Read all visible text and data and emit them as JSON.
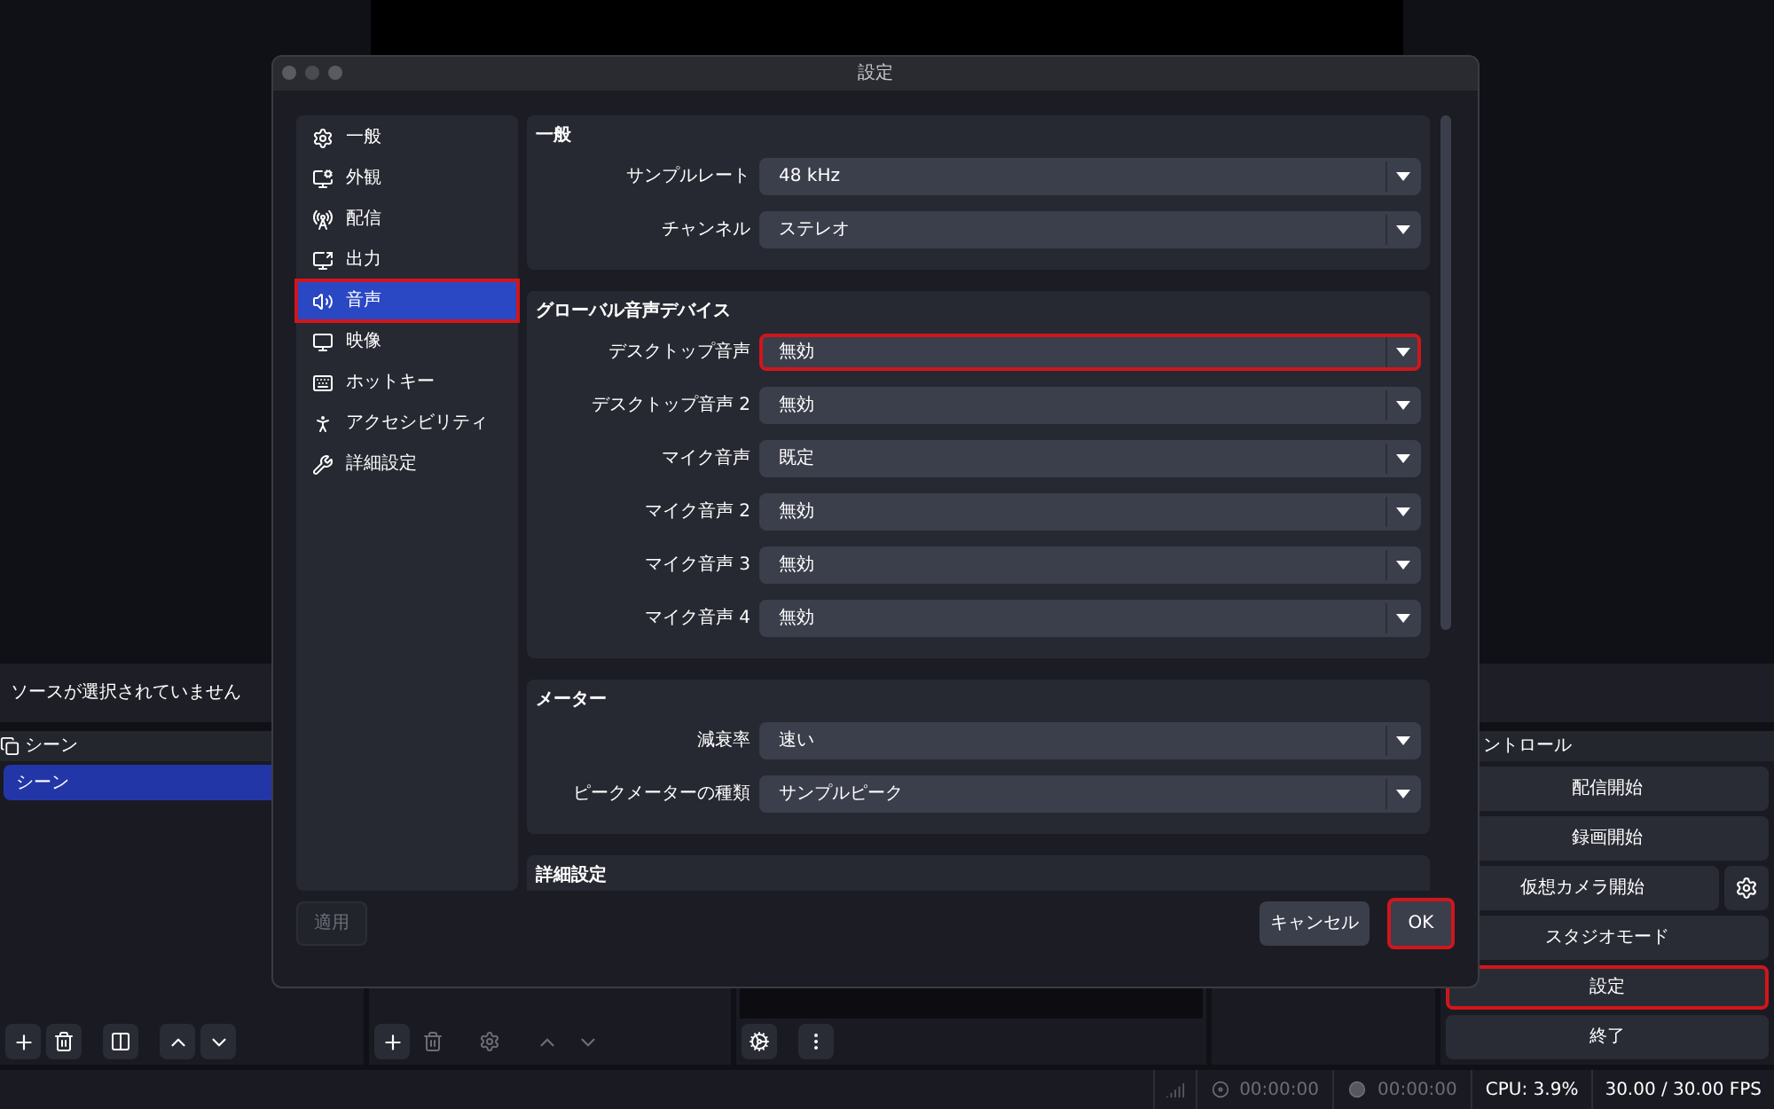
{
  "main_window": {
    "source_bar": {
      "text": "ソースが選択されていません"
    },
    "scenes_dock": {
      "title": "シーン",
      "items": [
        {
          "label": "シーン",
          "selected": true
        }
      ]
    },
    "controls_dock": {
      "title": "ントロール",
      "buttons": [
        {
          "label": "配信開始",
          "kind": "plain",
          "highlighted": false
        },
        {
          "label": "録画開始",
          "kind": "plain",
          "highlighted": false
        },
        {
          "label": "仮想カメラ開始",
          "kind": "with-settings",
          "highlighted": false
        },
        {
          "label": "スタジオモード",
          "kind": "plain",
          "highlighted": false
        },
        {
          "label": "設定",
          "kind": "plain",
          "highlighted": true
        },
        {
          "label": "終了",
          "kind": "plain",
          "highlighted": false
        }
      ]
    },
    "status_bar": {
      "stream_time": "00:00:00",
      "record_time": "00:00:00",
      "cpu": "CPU: 3.9%",
      "fps": "30.00 / 30.00 FPS"
    }
  },
  "dialog": {
    "title": "設定",
    "sidebar": [
      {
        "label": "一般",
        "selected": false,
        "highlighted": false
      },
      {
        "label": "外観",
        "selected": false,
        "highlighted": false
      },
      {
        "label": "配信",
        "selected": false,
        "highlighted": false
      },
      {
        "label": "出力",
        "selected": false,
        "highlighted": false
      },
      {
        "label": "音声",
        "selected": true,
        "highlighted": true
      },
      {
        "label": "映像",
        "selected": false,
        "highlighted": false
      },
      {
        "label": "ホットキー",
        "selected": false,
        "highlighted": false
      },
      {
        "label": "アクセシビリティ",
        "selected": false,
        "highlighted": false
      },
      {
        "label": "詳細設定",
        "selected": false,
        "highlighted": false
      }
    ],
    "sections": [
      {
        "title": "一般",
        "rows": [
          {
            "label": "サンプルレート",
            "value": "48 kHz",
            "highlighted": false
          },
          {
            "label": "チャンネル",
            "value": "ステレオ",
            "highlighted": false
          }
        ]
      },
      {
        "title": "グローバル音声デバイス",
        "rows": [
          {
            "label": "デスクトップ音声",
            "value": "無効",
            "highlighted": true
          },
          {
            "label": "デスクトップ音声 2",
            "value": "無効",
            "highlighted": false
          },
          {
            "label": "マイク音声",
            "value": "既定",
            "highlighted": false
          },
          {
            "label": "マイク音声 2",
            "value": "無効",
            "highlighted": false
          },
          {
            "label": "マイク音声 3",
            "value": "無効",
            "highlighted": false
          },
          {
            "label": "マイク音声 4",
            "value": "無効",
            "highlighted": false
          }
        ]
      },
      {
        "title": "メーター",
        "rows": [
          {
            "label": "減衰率",
            "value": "速い",
            "highlighted": false
          },
          {
            "label": "ピークメーターの種類",
            "value": "サンプルピーク",
            "highlighted": false
          }
        ]
      },
      {
        "title": "詳細設定"
      }
    ],
    "apply": {
      "label": "適用",
      "disabled": true
    },
    "cancel": {
      "label": "キャンセル"
    },
    "ok": {
      "label": "OK",
      "highlighted": true
    }
  }
}
